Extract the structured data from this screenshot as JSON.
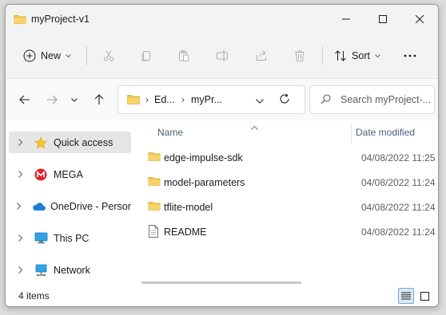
{
  "window": {
    "title": "myProject-v1"
  },
  "toolbar": {
    "new_label": "New",
    "sort_label": "Sort"
  },
  "address": {
    "crumbs": [
      "Ed...",
      "myPr..."
    ]
  },
  "search": {
    "placeholder": "Search myProject-..."
  },
  "sidebar": {
    "items": [
      {
        "label": "Quick access",
        "icon": "star-icon"
      },
      {
        "label": "MEGA",
        "icon": "mega-icon"
      },
      {
        "label": "OneDrive - Persona",
        "icon": "cloud-icon"
      },
      {
        "label": "This PC",
        "icon": "computer-icon"
      },
      {
        "label": "Network",
        "icon": "network-icon"
      }
    ]
  },
  "files": {
    "columns": {
      "name": "Name",
      "date": "Date modified"
    },
    "rows": [
      {
        "name": "edge-impulse-sdk",
        "date": "04/08/2022 11:25",
        "type": "folder"
      },
      {
        "name": "model-parameters",
        "date": "04/08/2022 11:24",
        "type": "folder"
      },
      {
        "name": "tflite-model",
        "date": "04/08/2022 11:24",
        "type": "folder"
      },
      {
        "name": "README",
        "date": "04/08/2022 11:24",
        "type": "file"
      }
    ]
  },
  "status": {
    "item_count": "4 items"
  },
  "colors": {
    "folder": "#f5c242",
    "accent": "#0067c0",
    "selected": "#e5e5e5"
  }
}
